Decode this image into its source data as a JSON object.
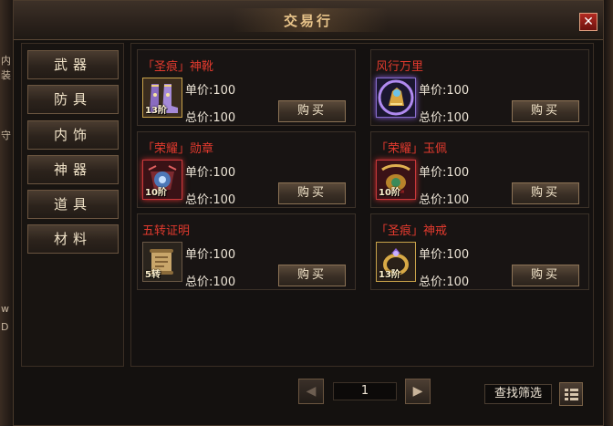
{
  "window": {
    "title": "交易行",
    "close_glyph": "✕"
  },
  "edge_fragments": [
    "内",
    "装",
    "守",
    "D",
    "w"
  ],
  "categories": [
    {
      "label": "武器"
    },
    {
      "label": "防具"
    },
    {
      "label": "内饰"
    },
    {
      "label": "神器"
    },
    {
      "label": "道具"
    },
    {
      "label": "材料"
    }
  ],
  "price_labels": {
    "unit": "单价:",
    "total": "总价:"
  },
  "buy_label": "购买",
  "items": [
    {
      "name": "「圣痕」神靴",
      "unit_price": "100",
      "total_price": "100",
      "tier": "13阶",
      "icon": "boots-icon",
      "name_color": "#e23a2e"
    },
    {
      "name": "风行万里",
      "unit_price": "100",
      "total_price": "100",
      "tier": "",
      "icon": "mount-icon",
      "name_color": "#e23a2e"
    },
    {
      "name": "「荣耀」勋章",
      "unit_price": "100",
      "total_price": "100",
      "tier": "10阶",
      "icon": "medal-icon",
      "name_color": "#e23a2e"
    },
    {
      "name": "「荣耀」玉佩",
      "unit_price": "100",
      "total_price": "100",
      "tier": "10阶",
      "icon": "jade-pendant-icon",
      "name_color": "#e23a2e"
    },
    {
      "name": "五转证明",
      "unit_price": "100",
      "total_price": "100",
      "tier": "5转",
      "icon": "scroll-icon",
      "name_color": "#e23a2e"
    },
    {
      "name": "「圣痕」神戒",
      "unit_price": "100",
      "total_price": "100",
      "tier": "13阶",
      "icon": "ring-icon",
      "name_color": "#e23a2e"
    }
  ],
  "pagination": {
    "current_page": "1",
    "prev_glyph": "◀",
    "next_glyph": "▶"
  },
  "filter_label": "查找筛选"
}
